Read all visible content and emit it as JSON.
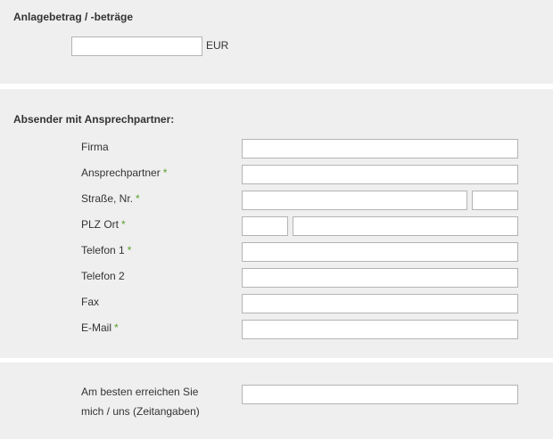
{
  "amount_section": {
    "title": "Anlagebetrag / -beträge",
    "amount_value": "",
    "currency": "EUR"
  },
  "sender_section": {
    "title": "Absender mit Ansprechpartner:",
    "required_marker": "*",
    "fields": {
      "firma": {
        "label": "Firma",
        "value": ""
      },
      "ansprechpartner": {
        "label": "Ansprechpartner",
        "value": ""
      },
      "strasse": {
        "label": "Straße, Nr.",
        "street_value": "",
        "number_value": ""
      },
      "plz_ort": {
        "label": "PLZ Ort",
        "plz_value": "",
        "ort_value": ""
      },
      "telefon1": {
        "label": "Telefon 1",
        "value": ""
      },
      "telefon2": {
        "label": "Telefon 2",
        "value": ""
      },
      "fax": {
        "label": "Fax",
        "value": ""
      },
      "email": {
        "label": "E-Mail",
        "value": ""
      }
    }
  },
  "reach_section": {
    "label_line1": "Am besten erreichen Sie",
    "label_line2": "mich / uns (Zeitangaben)",
    "value": ""
  },
  "colors": {
    "panel_bg": "#efefef",
    "required_marker": "#5aa02c",
    "input_border": "#b4b4b4"
  }
}
